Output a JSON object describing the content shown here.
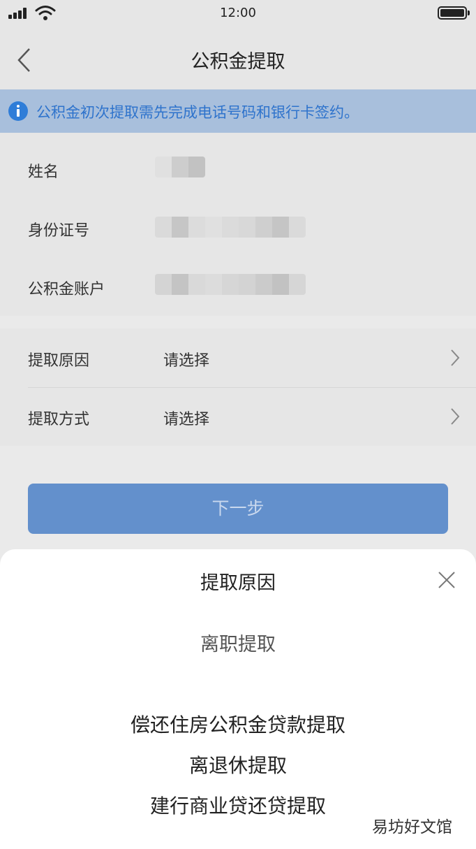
{
  "status_bar": {
    "time": "12:00"
  },
  "nav": {
    "title": "公积金提取"
  },
  "notice": {
    "text": "公积金初次提取需先完成电话号码和银行卡签约。"
  },
  "info_fields": [
    {
      "label": "姓名"
    },
    {
      "label": "身份证号"
    },
    {
      "label": "公积金账户"
    }
  ],
  "select_fields": [
    {
      "label": "提取原因",
      "value": "请选择"
    },
    {
      "label": "提取方式",
      "value": "请选择"
    }
  ],
  "next_button": {
    "label": "下一步"
  },
  "sheet": {
    "title": "提取原因",
    "options": [
      {
        "label": "离职提取",
        "selected": true
      },
      {
        "label": "偿还住房公积金贷款提取"
      },
      {
        "label": "离退休提取"
      },
      {
        "label": "建行商业贷还贷提取"
      }
    ]
  },
  "watermark": {
    "text": "易坊好文馆"
  },
  "colors": {
    "accent": "#6390cc",
    "notice_bg": "#a8bfdc",
    "notice_text": "#2e73cc",
    "info_icon": "#2f7dd8"
  }
}
